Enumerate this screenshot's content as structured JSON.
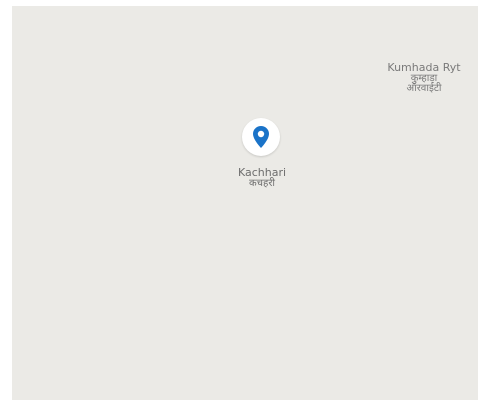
{
  "map": {
    "background_color": "#ebeae6",
    "pin": {
      "icon": "location-pin-icon",
      "color": "#1a73c8"
    },
    "places": [
      {
        "id": "kachhari",
        "name_en": "Kachhari",
        "name_hi": "कचहरी"
      },
      {
        "id": "kumhada",
        "name_en": "Kumhada Ryt",
        "name_hi_1": "कुम्हाड़ा",
        "name_hi_2": "ऑरवाईटी"
      }
    ]
  }
}
